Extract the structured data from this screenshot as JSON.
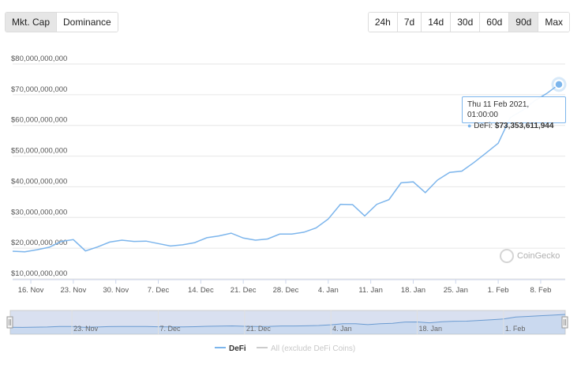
{
  "view_toggle": [
    {
      "label": "Mkt. Cap",
      "active": true
    },
    {
      "label": "Dominance",
      "active": false
    }
  ],
  "range_toggle": [
    {
      "label": "24h",
      "active": false
    },
    {
      "label": "7d",
      "active": false
    },
    {
      "label": "14d",
      "active": false
    },
    {
      "label": "30d",
      "active": false
    },
    {
      "label": "60d",
      "active": false
    },
    {
      "label": "90d",
      "active": true
    },
    {
      "label": "Max",
      "active": false
    }
  ],
  "watermark": "CoinGecko",
  "tooltip": {
    "date": "Thu 11 Feb 2021, 01:00:00",
    "series": "DeFi:",
    "value": "$73,353,611,944"
  },
  "colors": {
    "defi": "#7cb5ec",
    "all": "#cccccc",
    "grid": "#e6e6e6"
  },
  "chart_data": {
    "type": "line",
    "y_ticks": [
      {
        "value": 10000000000,
        "label": "$10,000,000,000"
      },
      {
        "value": 20000000000,
        "label": "$20,000,000,000"
      },
      {
        "value": 30000000000,
        "label": "$30,000,000,000"
      },
      {
        "value": 40000000000,
        "label": "$40,000,000,000"
      },
      {
        "value": 50000000000,
        "label": "$50,000,000,000"
      },
      {
        "value": 60000000000,
        "label": "$60,000,000,000"
      },
      {
        "value": 70000000000,
        "label": "$70,000,000,000"
      },
      {
        "value": 80000000000,
        "label": "$80,000,000,000"
      }
    ],
    "ylim": [
      10000000000,
      80000000000
    ],
    "x_range": [
      "2020-11-13",
      "2021-02-11"
    ],
    "x_ticks": [
      {
        "date": "2020-11-16",
        "label": "16. Nov"
      },
      {
        "date": "2020-11-23",
        "label": "23. Nov"
      },
      {
        "date": "2020-11-30",
        "label": "30. Nov"
      },
      {
        "date": "2020-12-07",
        "label": "7. Dec"
      },
      {
        "date": "2020-12-14",
        "label": "14. Dec"
      },
      {
        "date": "2020-12-21",
        "label": "21. Dec"
      },
      {
        "date": "2020-12-28",
        "label": "28. Dec"
      },
      {
        "date": "2021-01-04",
        "label": "4. Jan"
      },
      {
        "date": "2021-01-11",
        "label": "11. Jan"
      },
      {
        "date": "2021-01-18",
        "label": "18. Jan"
      },
      {
        "date": "2021-01-25",
        "label": "25. Jan"
      },
      {
        "date": "2021-02-01",
        "label": "1. Feb"
      },
      {
        "date": "2021-02-08",
        "label": "8. Feb"
      }
    ],
    "navigator_ticks": [
      {
        "date": "2020-11-23",
        "label": "23. Nov"
      },
      {
        "date": "2020-12-07",
        "label": "7. Dec"
      },
      {
        "date": "2020-12-21",
        "label": "21. Dec"
      },
      {
        "date": "2021-01-04",
        "label": "4. Jan"
      },
      {
        "date": "2021-01-18",
        "label": "18. Jan"
      },
      {
        "date": "2021-02-01",
        "label": "1. Feb"
      }
    ],
    "series": [
      {
        "name": "DeFi",
        "points": [
          [
            "2020-11-13",
            19000000000
          ],
          [
            "2020-11-15",
            18800000000
          ],
          [
            "2020-11-17",
            19500000000
          ],
          [
            "2020-11-19",
            20300000000
          ],
          [
            "2020-11-21",
            22200000000
          ],
          [
            "2020-11-23",
            22800000000
          ],
          [
            "2020-11-25",
            19100000000
          ],
          [
            "2020-11-27",
            20400000000
          ],
          [
            "2020-11-29",
            22000000000
          ],
          [
            "2020-12-01",
            22600000000
          ],
          [
            "2020-12-03",
            22200000000
          ],
          [
            "2020-12-05",
            22300000000
          ],
          [
            "2020-12-07",
            21500000000
          ],
          [
            "2020-12-09",
            20700000000
          ],
          [
            "2020-12-11",
            21100000000
          ],
          [
            "2020-12-13",
            21800000000
          ],
          [
            "2020-12-15",
            23400000000
          ],
          [
            "2020-12-17",
            24000000000
          ],
          [
            "2020-12-19",
            24900000000
          ],
          [
            "2020-12-21",
            23300000000
          ],
          [
            "2020-12-23",
            22600000000
          ],
          [
            "2020-12-25",
            23000000000
          ],
          [
            "2020-12-27",
            24600000000
          ],
          [
            "2020-12-29",
            24600000000
          ],
          [
            "2020-12-31",
            25200000000
          ],
          [
            "2021-01-02",
            26600000000
          ],
          [
            "2021-01-04",
            29500000000
          ],
          [
            "2021-01-06",
            34300000000
          ],
          [
            "2021-01-08",
            34200000000
          ],
          [
            "2021-01-10",
            30500000000
          ],
          [
            "2021-01-12",
            34300000000
          ],
          [
            "2021-01-14",
            35800000000
          ],
          [
            "2021-01-16",
            41300000000
          ],
          [
            "2021-01-18",
            41600000000
          ],
          [
            "2021-01-20",
            38100000000
          ],
          [
            "2021-01-22",
            42200000000
          ],
          [
            "2021-01-24",
            44700000000
          ],
          [
            "2021-01-26",
            45100000000
          ],
          [
            "2021-01-28",
            47900000000
          ],
          [
            "2021-01-30",
            51000000000
          ],
          [
            "2021-02-01",
            54200000000
          ],
          [
            "2021-02-03",
            62600000000
          ],
          [
            "2021-02-05",
            64900000000
          ],
          [
            "2021-02-07",
            68000000000
          ],
          [
            "2021-02-09",
            70400000000
          ],
          [
            "2021-02-11",
            73353611944
          ]
        ]
      },
      {
        "name": "All (exclude DeFi Coins)",
        "visible": false,
        "points": []
      }
    ],
    "legend_position": "bottom-center",
    "grid": true
  }
}
